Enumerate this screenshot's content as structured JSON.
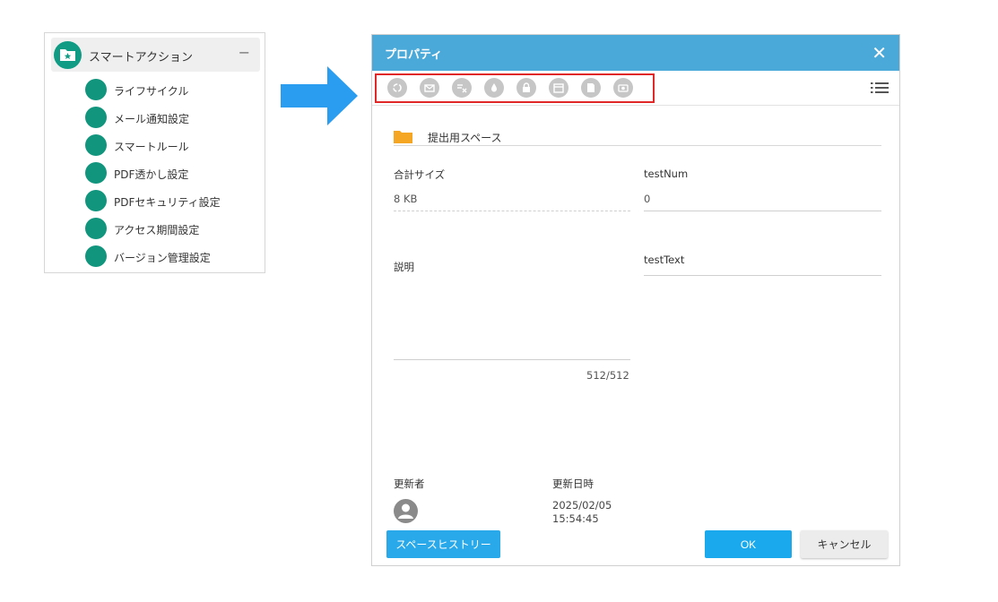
{
  "tree": {
    "title": "スマートアクション",
    "collapse": "−",
    "items": [
      {
        "label": "ライフサイクル"
      },
      {
        "label": "メール通知設定"
      },
      {
        "label": "スマートルール"
      },
      {
        "label": "PDF透かし設定"
      },
      {
        "label": "PDFセキュリティ設定"
      },
      {
        "label": "アクセス期間設定"
      },
      {
        "label": "バージョン管理設定"
      }
    ]
  },
  "dialog": {
    "title": "プロパティ",
    "close": "✕",
    "toolbar_icons": [
      "lifecycle-icon",
      "mail-notify-icon",
      "smart-rule-icon",
      "pdf-watermark-icon",
      "pdf-security-icon",
      "access-period-icon",
      "version-control-icon",
      "camera-icon"
    ],
    "folder_name": "提出用スペース",
    "total_size_label": "合計サイズ",
    "total_size_value": "8 KB",
    "test_num_label": "testNum",
    "test_num_value": "0",
    "description_label": "説明",
    "test_text_label": "testText",
    "char_count": "512/512",
    "updater_label": "更新者",
    "updated_at_label": "更新日時",
    "updated_at_date": "2025/02/05",
    "updated_at_time": "15:54:45",
    "history_button": "スペースヒストリー",
    "ok_button": "OK",
    "cancel_button": "キャンセル"
  },
  "colors": {
    "header": "#4aa9d8",
    "accent_teal": "#12957d",
    "primary_button": "#1ba9ee",
    "highlight": "#e02828",
    "arrow": "#2a9df0",
    "folder": "#f5a623"
  }
}
